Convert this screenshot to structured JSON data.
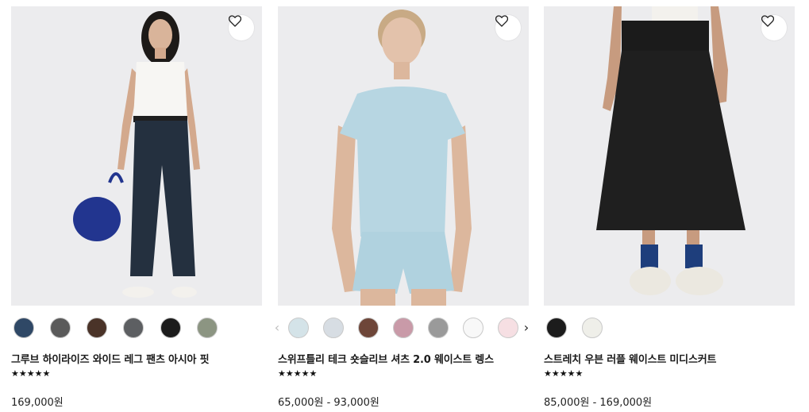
{
  "products": [
    {
      "name": "그루브 하이라이즈 와이드 레그 팬츠 아시아 핏",
      "rating_stars": "★★★★★",
      "price": "169,000원",
      "swatches": [
        "#2f4866",
        "#5a5a5a",
        "#4a3328",
        "#5d5f62",
        "#1c1c1c",
        "#8c9582"
      ],
      "has_prev_arrow": false,
      "has_next_arrow": false
    },
    {
      "name": "스위프틀리 테크 숏슬리브 셔츠 2.0 웨이스트 렝스",
      "rating_stars": "★★★★★",
      "price": "65,000원 - 93,000원",
      "swatches": [
        "#d4e3e8",
        "#d7dde3",
        "#6e4639",
        "#c99aa8",
        "#9a9a9a",
        "#f8f8f8",
        "#f6dfe3"
      ],
      "has_prev_arrow": true,
      "has_next_arrow": true
    },
    {
      "name": "스트레치 우븐 러플 웨이스트 미디스커트",
      "rating_stars": "★★★★★",
      "price": "85,000원 - 169,000원",
      "swatches": [
        "#1c1c1c",
        "#efefe9"
      ],
      "has_prev_arrow": false,
      "has_next_arrow": false
    }
  ],
  "icons": {
    "wishlist": "heart-outline-icon",
    "prev": "chevron-left-icon",
    "next": "chevron-right-icon"
  },
  "arrows": {
    "prev": "‹",
    "next": "›"
  }
}
